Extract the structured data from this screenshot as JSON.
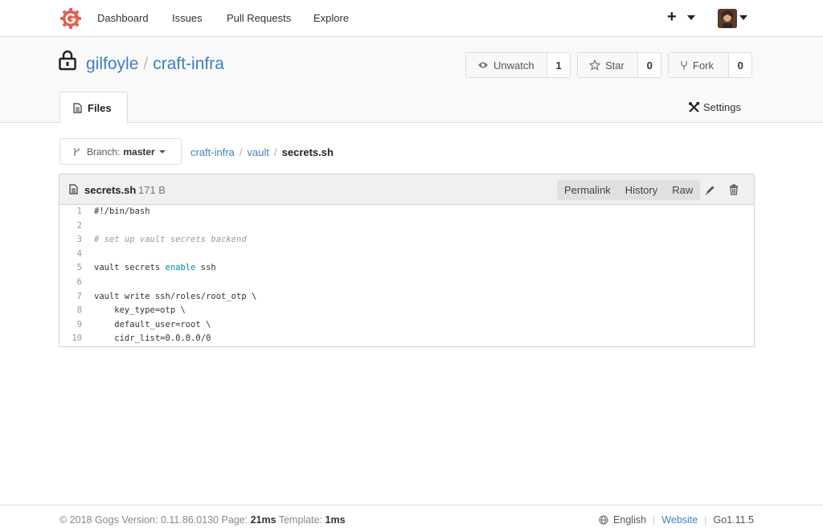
{
  "nav": {
    "items": [
      "Dashboard",
      "Issues",
      "Pull Requests",
      "Explore"
    ],
    "plus": "+"
  },
  "repo": {
    "owner": "gilfoyle",
    "separator": "/",
    "name": "craft-infra",
    "watch_label": "Unwatch",
    "watch_count": "1",
    "star_label": "Star",
    "star_count": "0",
    "fork_label": "Fork",
    "fork_count": "0"
  },
  "tabs": {
    "files": "Files",
    "settings": "Settings"
  },
  "branch": {
    "label": "Branch:",
    "value": "master"
  },
  "breadcrumb": {
    "items": [
      "craft-infra",
      "vault"
    ],
    "current": "secrets.sh"
  },
  "file": {
    "name": "secrets.sh",
    "size": "171 B",
    "buttons": [
      "Permalink",
      "History",
      "Raw"
    ],
    "lines": [
      {
        "n": "1",
        "text": "#!/bin/bash"
      },
      {
        "n": "2",
        "text": ""
      },
      {
        "n": "3",
        "text": "# set up vault secrets backend"
      },
      {
        "n": "4",
        "text": ""
      },
      {
        "n": "5",
        "text": "vault secrets enable ssh"
      },
      {
        "n": "6",
        "text": ""
      },
      {
        "n": "7",
        "text": "vault write ssh/roles/root_otp \\"
      },
      {
        "n": "8",
        "text": "    key_type=otp \\"
      },
      {
        "n": "9",
        "text": "    default_user=root \\"
      },
      {
        "n": "10",
        "text": "    cidr_list=0.0.0.0/0"
      }
    ]
  },
  "footer": {
    "copyright": "© 2018 Gogs Version: 0.11.86.0130 Page: ",
    "page_time": "21ms",
    "template_label": " Template: ",
    "template_time": "1ms",
    "language": "English",
    "website": "Website",
    "go_version": "Go1.11.5"
  },
  "colors": {
    "brand": "#e25f4e",
    "link": "#3f7fbf",
    "keyword": "#0086b3"
  }
}
